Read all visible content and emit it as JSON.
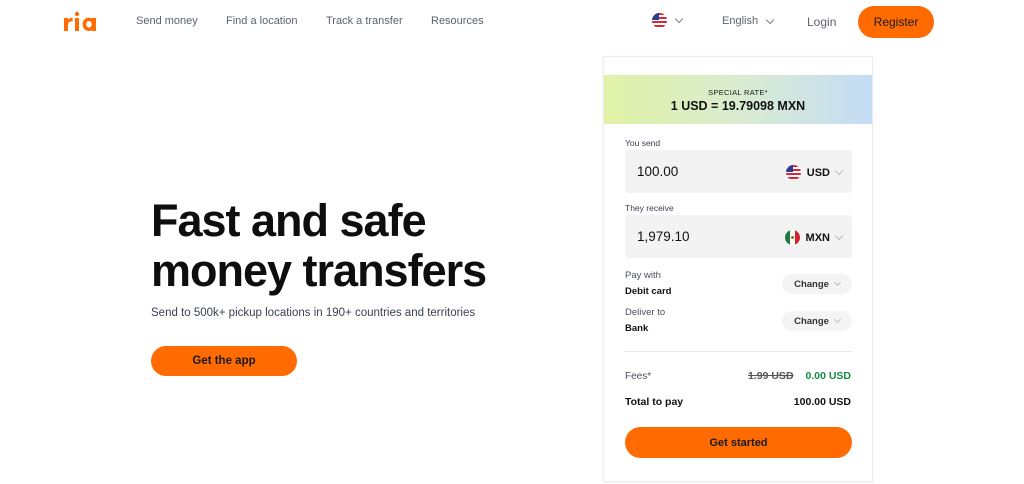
{
  "brand": {
    "logo_text": "ria",
    "accent_color": "#ff6b00"
  },
  "nav": {
    "links": [
      "Send money",
      "Find a location",
      "Track a transfer",
      "Resources"
    ],
    "country_flag": "us-flag",
    "language": "English",
    "login": "Login",
    "register": "Register"
  },
  "hero": {
    "title": "Fast and safe money transfers",
    "subtitle": "Send to 500k+ pickup locations in 190+ countries and territories",
    "cta": "Get the app"
  },
  "converter": {
    "rate_label": "SPECIAL RATE*",
    "rate_value": "1 USD = 19.79098 MXN",
    "send_label": "You send",
    "send_amount": "100.00",
    "send_currency": "USD",
    "receive_label": "They receive",
    "receive_amount": "1,979.10",
    "receive_currency": "MXN",
    "pay_with_label": "Pay with",
    "pay_with_value": "Debit card",
    "deliver_to_label": "Deliver to",
    "deliver_to_value": "Bank",
    "change_label": "Change",
    "fees_label": "Fees*",
    "fees_original": "1.99 USD",
    "fees_discounted": "0.00 USD",
    "total_label": "Total to pay",
    "total_value": "100.00 USD",
    "cta": "Get started",
    "discount_color": "#178a45"
  }
}
